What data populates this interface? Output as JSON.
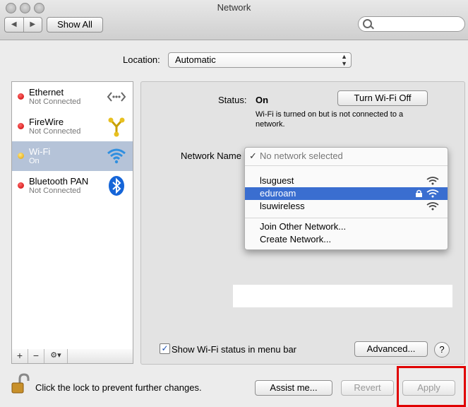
{
  "window": {
    "title": "Network"
  },
  "toolbar": {
    "back": "◀",
    "forward": "▶",
    "show_all_label": "Show All",
    "search_icon": "search-icon"
  },
  "location": {
    "label": "Location:",
    "value": "Automatic"
  },
  "services": [
    {
      "name": "Ethernet",
      "status": "Not Connected",
      "status_color": "red",
      "icon": "ethernet-icon"
    },
    {
      "name": "FireWire",
      "status": "Not Connected",
      "status_color": "red",
      "icon": "firewire-icon"
    },
    {
      "name": "Wi-Fi",
      "status": "On",
      "status_color": "yellow",
      "icon": "wifi-icon",
      "selected": true
    },
    {
      "name": "Bluetooth PAN",
      "status": "Not Connected",
      "status_color": "red",
      "icon": "bluetooth-icon"
    }
  ],
  "sidebar_tools": {
    "add": "+",
    "remove": "−",
    "action": "⚙▾"
  },
  "detail": {
    "status_label": "Status:",
    "status_value": "On",
    "turn_off_label": "Turn Wi-Fi Off",
    "status_description": "Wi-Fi is turned on but is not connected to a network.",
    "network_name_label": "Network Name"
  },
  "network_dropdown": {
    "checked_item": "No network selected",
    "networks": [
      {
        "name": "lsuguest",
        "locked": false
      },
      {
        "name": "eduroam",
        "locked": true,
        "highlighted": true
      },
      {
        "name": "lsuwireless",
        "locked": false
      }
    ],
    "actions": [
      "Join Other Network...",
      "Create Network..."
    ]
  },
  "footer_panel": {
    "show_status_label": "Show Wi-Fi status in menu bar",
    "show_status_checked": true,
    "advanced_label": "Advanced...",
    "help_label": "?"
  },
  "bottom": {
    "lock_text": "Click the lock to prevent further changes.",
    "assist_label": "Assist me...",
    "revert_label": "Revert",
    "apply_label": "Apply"
  },
  "colors": {
    "selection": "#b5c3d8",
    "highlight": "#3a6ed0",
    "annotation": "#e00000"
  }
}
